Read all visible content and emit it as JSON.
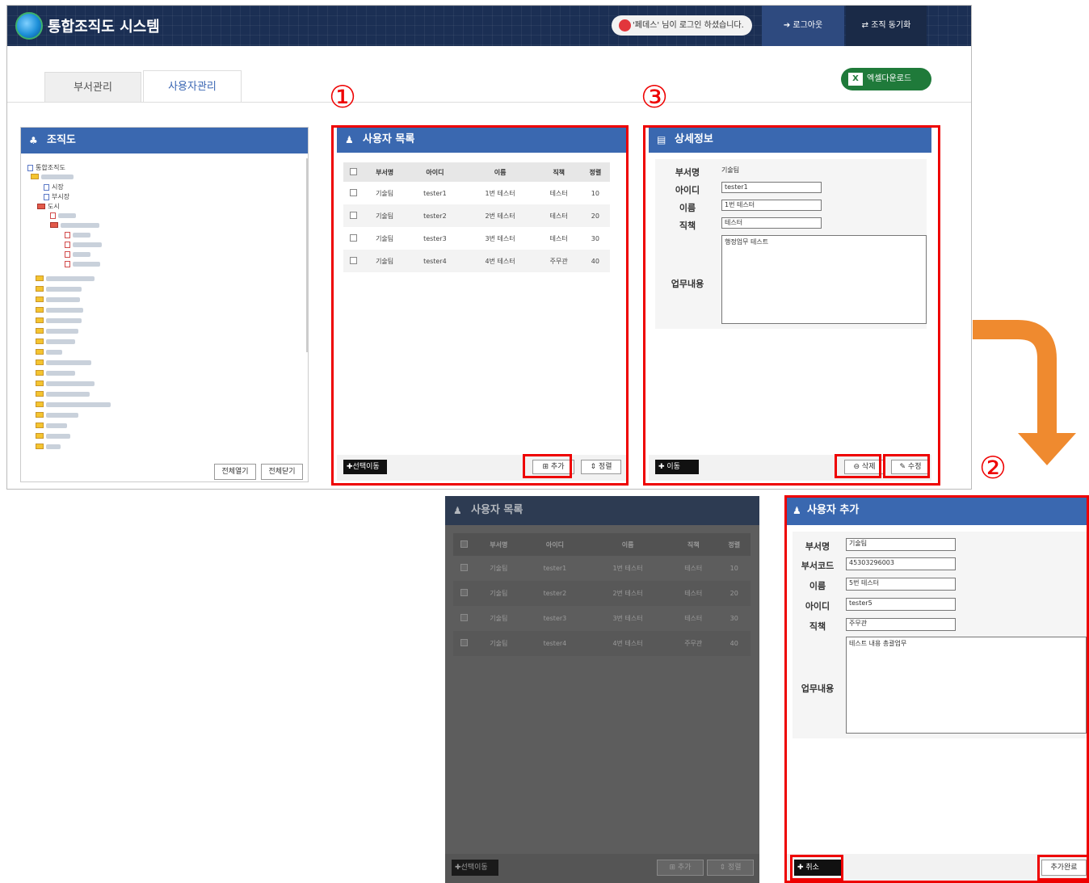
{
  "header": {
    "app_title": "통합조직도 시스템",
    "login_message": "'페데스' 님이 로그인 하셨습니다.",
    "logout_label": "로그아웃",
    "sync_label": "조직 동기화"
  },
  "tabs": [
    {
      "label": "부서관리"
    },
    {
      "label": "사용자관리"
    }
  ],
  "excel_download_label": "엑셀다운로드",
  "org_panel": {
    "title": "조직도",
    "root": "통합조직도",
    "nodes": [
      "시장",
      "부시장",
      "도시"
    ],
    "expand_all": "전체열기",
    "collapse_all": "전체닫기"
  },
  "markers": [
    "①",
    "②",
    "③"
  ],
  "user_list": {
    "title": "사용자 목록",
    "columns": [
      "부서명",
      "아이디",
      "이름",
      "직책",
      "정렬"
    ],
    "rows": [
      [
        "기술팀",
        "tester1",
        "1번 테스터",
        "테스터",
        "10"
      ],
      [
        "기술팀",
        "tester2",
        "2번 테스터",
        "테스터",
        "20"
      ],
      [
        "기술팀",
        "tester3",
        "3번 테스터",
        "테스터",
        "30"
      ],
      [
        "기술팀",
        "tester4",
        "4번 테스터",
        "주무관",
        "40"
      ]
    ],
    "move_selected": "선택이동",
    "add": "추가",
    "sort": "정렬"
  },
  "detail": {
    "title": "상세정보",
    "fields": [
      {
        "label": "부서명",
        "value": "기술팀"
      },
      {
        "label": "아이디",
        "value": "tester1"
      },
      {
        "label": "이름",
        "value": "1번 테스터"
      },
      {
        "label": "직책",
        "value": "테스터"
      }
    ],
    "work_label": "업무내용",
    "work_value": "행정업무 테스트",
    "move": "이동",
    "delete": "삭제",
    "edit": "수정"
  },
  "add_user": {
    "title": "사용자 추가",
    "fields": [
      {
        "label": "부서명",
        "value": "기술팀"
      },
      {
        "label": "부서코드",
        "value": "45303296003"
      },
      {
        "label": "이름",
        "value": "5번 테스터"
      },
      {
        "label": "아이디",
        "value": "tester5"
      },
      {
        "label": "직책",
        "value": "주무관"
      }
    ],
    "work_label": "업무내용",
    "work_value": "테스트 내용 총괄업무",
    "cancel": "취소",
    "complete": "추가완료"
  },
  "colors": {
    "header_bg": "#1b2f54",
    "panel_head": "#3a68b0",
    "highlight": "#e00000",
    "arrow": "#ef8a2f",
    "excel": "#1f7a3a"
  }
}
